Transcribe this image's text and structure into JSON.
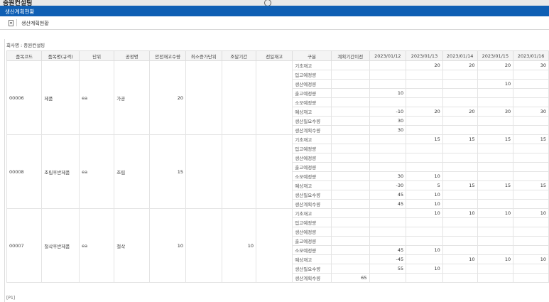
{
  "background_app": {
    "title": "중원컨설팅"
  },
  "window": {
    "title": "생산계획현황"
  },
  "breadcrumb": {
    "label": "생산계획현황"
  },
  "company_label": "회사명 : 중원컨설팅",
  "footer": {
    "page": "[P1]"
  },
  "columns": [
    "품목코드",
    "품목명(규격)",
    "단위",
    "공정명",
    "안전재고수량",
    "최소증가단위",
    "조달기간",
    "전일재고",
    "구분",
    "계획기간이전",
    "2023/01/12",
    "2023/01/13",
    "2023/01/14",
    "2023/01/15",
    "2023/01/16"
  ],
  "row_labels": [
    "기초재고",
    "입고예정량",
    "생산예정량",
    "출고예정량",
    "소모예정량",
    "예상재고",
    "생산필요수량",
    "생산계획수량"
  ],
  "items": [
    {
      "code": "00006",
      "name": "제품",
      "unit": "ea",
      "process": "가공",
      "safety": "20",
      "min_inc": "",
      "lead": "",
      "prev_stock": "",
      "rows": [
        [
          "",
          "",
          "20",
          "20",
          "20",
          "30"
        ],
        [
          "",
          "",
          "",
          "",
          "",
          ""
        ],
        [
          "",
          "",
          "",
          "",
          "10",
          ""
        ],
        [
          "",
          "10",
          "",
          "",
          "",
          ""
        ],
        [
          "",
          "",
          "",
          "",
          "",
          ""
        ],
        [
          "",
          "-10",
          "20",
          "20",
          "30",
          "30"
        ],
        [
          "",
          "30",
          "",
          "",
          "",
          ""
        ],
        [
          "",
          "30",
          "",
          "",
          "",
          ""
        ]
      ]
    },
    {
      "code": "00008",
      "name": "조립후반제품",
      "unit": "ea",
      "process": "조립",
      "safety": "15",
      "min_inc": "",
      "lead": "",
      "prev_stock": "",
      "rows": [
        [
          "",
          "",
          "15",
          "15",
          "15",
          "15"
        ],
        [
          "",
          "",
          "",
          "",
          "",
          ""
        ],
        [
          "",
          "",
          "",
          "",
          "",
          ""
        ],
        [
          "",
          "",
          "",
          "",
          "",
          ""
        ],
        [
          "",
          "30",
          "10",
          "",
          "",
          ""
        ],
        [
          "",
          "-30",
          "5",
          "15",
          "15",
          "15"
        ],
        [
          "",
          "45",
          "10",
          "",
          "",
          ""
        ],
        [
          "",
          "45",
          "10",
          "",
          "",
          ""
        ]
      ]
    },
    {
      "code": "00007",
      "name": "절삭후반제품",
      "unit": "ea",
      "process": "절삭",
      "safety": "10",
      "min_inc": "",
      "lead": "10",
      "prev_stock": "",
      "rows": [
        [
          "",
          "",
          "10",
          "10",
          "10",
          "10"
        ],
        [
          "",
          "",
          "",
          "",
          "",
          ""
        ],
        [
          "",
          "",
          "",
          "",
          "",
          ""
        ],
        [
          "",
          "",
          "",
          "",
          "",
          ""
        ],
        [
          "",
          "45",
          "10",
          "",
          "",
          ""
        ],
        [
          "",
          "-45",
          "",
          "10",
          "10",
          "10"
        ],
        [
          "",
          "55",
          "10",
          "",
          "",
          ""
        ],
        [
          "65",
          "",
          "",
          "",
          "",
          ""
        ]
      ]
    }
  ]
}
